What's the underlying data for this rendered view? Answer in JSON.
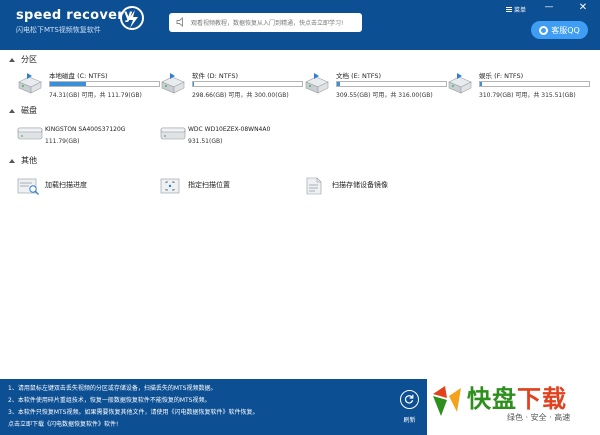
{
  "header": {
    "logo_title": "speed recovery",
    "logo_subtitle": "闪电松下MTS视频恢复软件",
    "notice": "观看视频教程，数据恢复从入门到精通，快点击立即学习!",
    "menu_label": "菜单",
    "minimize_symbol": "—",
    "close_symbol": "✕",
    "qq_label": "客服QQ",
    "colors": {
      "header_bg": "#0d4f93",
      "qq_bg": "#3f9df4"
    }
  },
  "sections": {
    "partitions": "分区",
    "disks": "磁盘",
    "others": "其他"
  },
  "partitions": [
    {
      "name": "本地磁盘 (C: NTFS)",
      "size": "74.31(GB) 可用，共 111.79(GB)",
      "fill": 0.33
    },
    {
      "name": "软件 (D: NTFS)",
      "size": "298.66(GB) 可用，共 300.00(GB)",
      "fill": 0.01
    },
    {
      "name": "文档 (E: NTFS)",
      "size": "309.55(GB) 可用，共 316.00(GB)",
      "fill": 0.03
    },
    {
      "name": "娱乐 (F: NTFS)",
      "size": "310.79(GB) 可用，共 315.51(GB)",
      "fill": 0.02
    }
  ],
  "disks": [
    {
      "name": "KINGSTON SA400S37120G",
      "size": "111.79(GB)"
    },
    {
      "name": "WDC WD10EZEX-08WN4A0",
      "size": "931.51(GB)"
    }
  ],
  "others": [
    {
      "label": "加载扫描进度",
      "icon": "load-scan-icon"
    },
    {
      "label": "指定扫描位置",
      "icon": "target-scan-icon"
    },
    {
      "label": "扫描存储设备镜像",
      "icon": "image-scan-icon"
    }
  ],
  "footer": {
    "tips": [
      "1、请用鼠标左键双击丢失视频的分区或存储设备，扫描丢失的MTS视频数据。",
      "2、本软件使用碎片重组技术，恢复一般数据恢复软件不能恢复的MTS视频。",
      "3、本软件只恢复MTS视频。如果需要恢复其他文件，请使用《闪电数据恢复软件》软件恢复。",
      "   点击立即下载《闪电数据恢复软件》软件!"
    ],
    "refresh_label": "刷新"
  },
  "brand": {
    "name_main": "快盘",
    "name_accent": "下载",
    "slogan": "绿色 · 安全 · 高速"
  }
}
